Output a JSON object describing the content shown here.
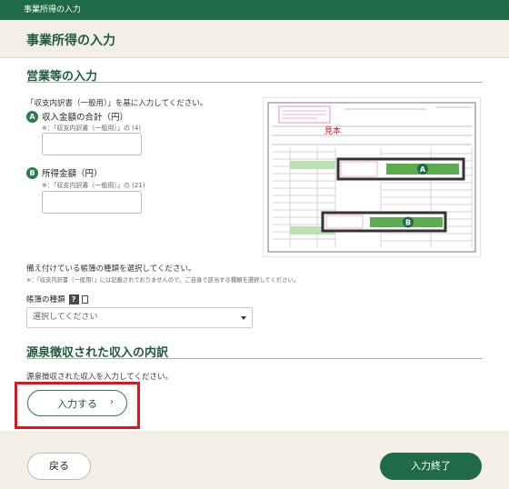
{
  "header": {
    "breadcrumb": "事業所得の入力",
    "title": "事業所得の入力"
  },
  "business_section": {
    "title": "営業等の入力",
    "instruction": "「収支内訳書（一般用）」を基に入力してください。",
    "field_a": {
      "badge": "A",
      "label": "収入金額の合計（円）",
      "note": "※：「収支内訳書（一般用）」の (4)",
      "value": ""
    },
    "field_b": {
      "badge": "B",
      "label": "所得金額（円）",
      "note": "※：「収支内訳書（一般用）」の (21)",
      "value": ""
    },
    "form_image": {
      "sample_label": "見本",
      "marker_a": "A",
      "marker_b": "B"
    },
    "ledger_instruction": "備え付けている帳簿の種類を選択してください。",
    "ledger_note": "※：「収支内訳書（一般用）」には記載されておりませんので、ご自身で該当する種類を選択してください。",
    "ledger_type_label": "帳簿の種類",
    "ledger_help_icon": "question-icon",
    "ledger_select_placeholder": "選択してください"
  },
  "withholding_section": {
    "title": "源泉徴収された収入の内訳",
    "instruction": "源泉徴収された収入を入力してください。",
    "enter_button": "入力する",
    "enter_chevron": "›",
    "highlight_color": "#e0141b"
  },
  "footer": {
    "back_button": "戻る",
    "finish_button": "入力終了"
  },
  "colors": {
    "brand_green": "#1f6b45",
    "background": "#f3efe6"
  }
}
